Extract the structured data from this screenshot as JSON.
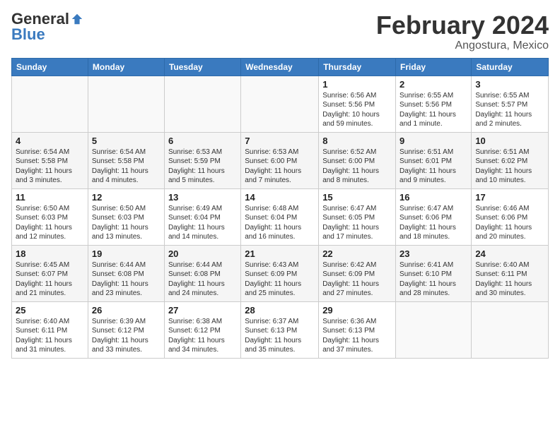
{
  "logo": {
    "general": "General",
    "blue": "Blue"
  },
  "title": "February 2024",
  "location": "Angostura, Mexico",
  "days_of_week": [
    "Sunday",
    "Monday",
    "Tuesday",
    "Wednesday",
    "Thursday",
    "Friday",
    "Saturday"
  ],
  "weeks": [
    [
      {
        "num": "",
        "info": ""
      },
      {
        "num": "",
        "info": ""
      },
      {
        "num": "",
        "info": ""
      },
      {
        "num": "",
        "info": ""
      },
      {
        "num": "1",
        "info": "Sunrise: 6:56 AM\nSunset: 5:56 PM\nDaylight: 10 hours and 59 minutes."
      },
      {
        "num": "2",
        "info": "Sunrise: 6:55 AM\nSunset: 5:56 PM\nDaylight: 11 hours and 1 minute."
      },
      {
        "num": "3",
        "info": "Sunrise: 6:55 AM\nSunset: 5:57 PM\nDaylight: 11 hours and 2 minutes."
      }
    ],
    [
      {
        "num": "4",
        "info": "Sunrise: 6:54 AM\nSunset: 5:58 PM\nDaylight: 11 hours and 3 minutes."
      },
      {
        "num": "5",
        "info": "Sunrise: 6:54 AM\nSunset: 5:58 PM\nDaylight: 11 hours and 4 minutes."
      },
      {
        "num": "6",
        "info": "Sunrise: 6:53 AM\nSunset: 5:59 PM\nDaylight: 11 hours and 5 minutes."
      },
      {
        "num": "7",
        "info": "Sunrise: 6:53 AM\nSunset: 6:00 PM\nDaylight: 11 hours and 7 minutes."
      },
      {
        "num": "8",
        "info": "Sunrise: 6:52 AM\nSunset: 6:00 PM\nDaylight: 11 hours and 8 minutes."
      },
      {
        "num": "9",
        "info": "Sunrise: 6:51 AM\nSunset: 6:01 PM\nDaylight: 11 hours and 9 minutes."
      },
      {
        "num": "10",
        "info": "Sunrise: 6:51 AM\nSunset: 6:02 PM\nDaylight: 11 hours and 10 minutes."
      }
    ],
    [
      {
        "num": "11",
        "info": "Sunrise: 6:50 AM\nSunset: 6:03 PM\nDaylight: 11 hours and 12 minutes."
      },
      {
        "num": "12",
        "info": "Sunrise: 6:50 AM\nSunset: 6:03 PM\nDaylight: 11 hours and 13 minutes."
      },
      {
        "num": "13",
        "info": "Sunrise: 6:49 AM\nSunset: 6:04 PM\nDaylight: 11 hours and 14 minutes."
      },
      {
        "num": "14",
        "info": "Sunrise: 6:48 AM\nSunset: 6:04 PM\nDaylight: 11 hours and 16 minutes."
      },
      {
        "num": "15",
        "info": "Sunrise: 6:47 AM\nSunset: 6:05 PM\nDaylight: 11 hours and 17 minutes."
      },
      {
        "num": "16",
        "info": "Sunrise: 6:47 AM\nSunset: 6:06 PM\nDaylight: 11 hours and 18 minutes."
      },
      {
        "num": "17",
        "info": "Sunrise: 6:46 AM\nSunset: 6:06 PM\nDaylight: 11 hours and 20 minutes."
      }
    ],
    [
      {
        "num": "18",
        "info": "Sunrise: 6:45 AM\nSunset: 6:07 PM\nDaylight: 11 hours and 21 minutes."
      },
      {
        "num": "19",
        "info": "Sunrise: 6:44 AM\nSunset: 6:08 PM\nDaylight: 11 hours and 23 minutes."
      },
      {
        "num": "20",
        "info": "Sunrise: 6:44 AM\nSunset: 6:08 PM\nDaylight: 11 hours and 24 minutes."
      },
      {
        "num": "21",
        "info": "Sunrise: 6:43 AM\nSunset: 6:09 PM\nDaylight: 11 hours and 25 minutes."
      },
      {
        "num": "22",
        "info": "Sunrise: 6:42 AM\nSunset: 6:09 PM\nDaylight: 11 hours and 27 minutes."
      },
      {
        "num": "23",
        "info": "Sunrise: 6:41 AM\nSunset: 6:10 PM\nDaylight: 11 hours and 28 minutes."
      },
      {
        "num": "24",
        "info": "Sunrise: 6:40 AM\nSunset: 6:11 PM\nDaylight: 11 hours and 30 minutes."
      }
    ],
    [
      {
        "num": "25",
        "info": "Sunrise: 6:40 AM\nSunset: 6:11 PM\nDaylight: 11 hours and 31 minutes."
      },
      {
        "num": "26",
        "info": "Sunrise: 6:39 AM\nSunset: 6:12 PM\nDaylight: 11 hours and 33 minutes."
      },
      {
        "num": "27",
        "info": "Sunrise: 6:38 AM\nSunset: 6:12 PM\nDaylight: 11 hours and 34 minutes."
      },
      {
        "num": "28",
        "info": "Sunrise: 6:37 AM\nSunset: 6:13 PM\nDaylight: 11 hours and 35 minutes."
      },
      {
        "num": "29",
        "info": "Sunrise: 6:36 AM\nSunset: 6:13 PM\nDaylight: 11 hours and 37 minutes."
      },
      {
        "num": "",
        "info": ""
      },
      {
        "num": "",
        "info": ""
      }
    ]
  ]
}
